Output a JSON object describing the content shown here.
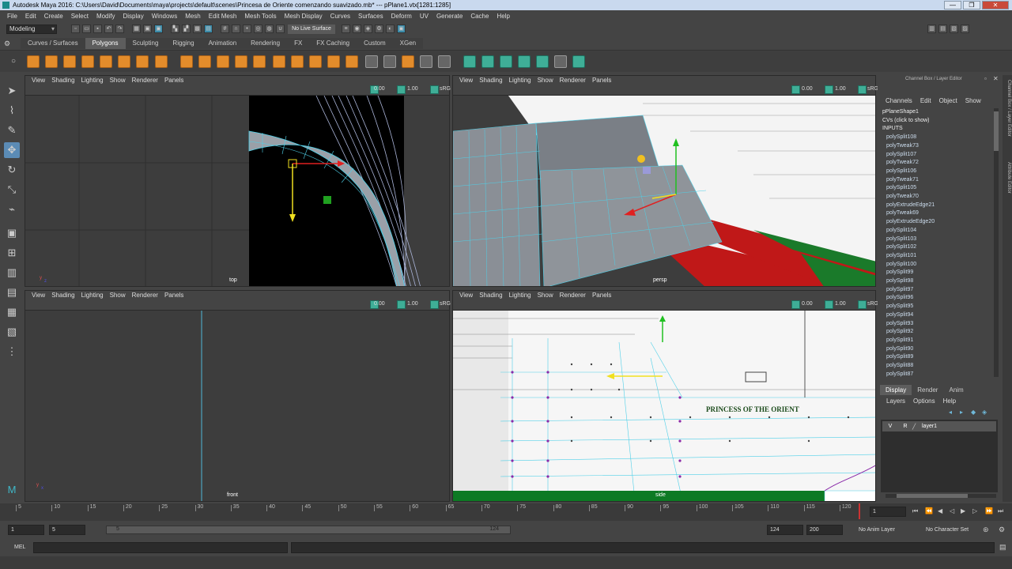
{
  "window": {
    "title": "Autodesk Maya 2016: C:\\Users\\David\\Documents\\maya\\projects\\default\\scenes\\Princesa de Oriente comenzando suavizado.mb*  ---  pPlane1.vtx[1281:1285]",
    "controls": [
      "—",
      "❐",
      "✕"
    ]
  },
  "menubar": [
    "File",
    "Edit",
    "Create",
    "Select",
    "Modify",
    "Display",
    "Windows",
    "Mesh",
    "Edit Mesh",
    "Mesh Tools",
    "Mesh Display",
    "Curves",
    "Surfaces",
    "Deform",
    "UV",
    "Generate",
    "Cache",
    "Help"
  ],
  "statusline": {
    "mode": "Modeling",
    "live_surface": "No Live Surface"
  },
  "shelf": {
    "tabs": [
      "Curves / Surfaces",
      "Polygons",
      "Sculpting",
      "Rigging",
      "Animation",
      "Rendering",
      "FX",
      "FX Caching",
      "Custom",
      "XGen"
    ],
    "active": "Polygons"
  },
  "panel_menu": [
    "View",
    "Shading",
    "Lighting",
    "Show",
    "Renderer",
    "Panels"
  ],
  "panel_values": {
    "a": "0.00",
    "b": "1.00",
    "c": "sRG"
  },
  "viewports": {
    "top": "top",
    "persp": "persp",
    "front": "front",
    "side": "side"
  },
  "ship_text": "PRINCESS OF THE ORIENT",
  "channel_box": {
    "title": "Channel Box / Layer Editor",
    "menu": [
      "Channels",
      "Edit",
      "Object",
      "Show"
    ],
    "object": "pPlaneShape1",
    "cvs": "CVs (click to show)",
    "inputs_label": "INPUTS",
    "inputs": [
      "polySplit108",
      "polyTweak73",
      "polySplit107",
      "polyTweak72",
      "polySplit106",
      "polyTweak71",
      "polySplit105",
      "polyTweak70",
      "polyExtrudeEdge21",
      "polyTweak69",
      "polyExtrudeEdge20",
      "polySplit104",
      "polySplit103",
      "polySplit102",
      "polySplit101",
      "polySplit100",
      "polySplit99",
      "polySplit98",
      "polySplit97",
      "polySplit96",
      "polySplit95",
      "polySplit94",
      "polySplit93",
      "polySplit92",
      "polySplit91",
      "polySplit90",
      "polySplit89",
      "polySplit88",
      "polySplit87"
    ]
  },
  "layer_editor": {
    "tabs": [
      "Display",
      "Render",
      "Anim"
    ],
    "active": "Display",
    "menu": [
      "Layers",
      "Options",
      "Help"
    ],
    "layer": {
      "v": "V",
      "r": "R",
      "name": "layer1"
    }
  },
  "side_tabs": [
    "Channel Box / Layer Editor",
    "Attribute Editor"
  ],
  "timeline": {
    "ticks": [
      "5",
      "10",
      "15",
      "20",
      "25",
      "30",
      "35",
      "40",
      "45",
      "50",
      "55",
      "60",
      "65",
      "70",
      "75",
      "80",
      "85",
      "90",
      "95",
      "100",
      "105",
      "110",
      "115",
      "120"
    ],
    "current_frame": "1"
  },
  "range": {
    "start": "1",
    "playback_start": "5",
    "slider_start": "5",
    "slider_end": "124",
    "playback_end": "124",
    "end": "200",
    "anim_layer": "No Anim Layer",
    "character_set": "No Character Set"
  },
  "command": {
    "label": "MEL"
  },
  "colors": {
    "accent": "#5b8bb5",
    "shelf_orange": "#e38c2b",
    "shelf_green": "#3fae97",
    "manip_red": "#e02020",
    "manip_green": "#20c020",
    "manip_yellow": "#f0e020",
    "wire_cyan": "#4fd0e8"
  }
}
